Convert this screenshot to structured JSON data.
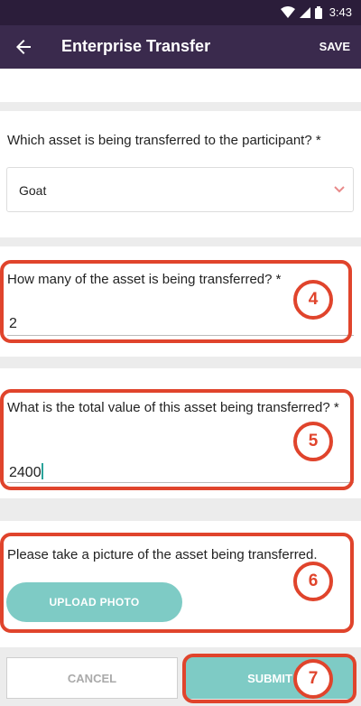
{
  "status_bar": {
    "time": "3:43",
    "icons": [
      "wifi-icon",
      "signal-icon",
      "battery-icon"
    ]
  },
  "app_bar": {
    "title": "Enterprise Transfer",
    "save_label": "SAVE"
  },
  "questions": {
    "asset_type": {
      "label": "Which asset is being transferred to the participant? *",
      "value": "Goat"
    },
    "asset_quantity": {
      "label": "How many of the asset is being transferred? *",
      "value": "2",
      "annotation": "4"
    },
    "asset_value": {
      "label": "What is the total value of this asset being transferred? *",
      "value": "2400",
      "annotation": "5"
    },
    "asset_photo": {
      "label": "Please take a picture of the asset being transferred.",
      "button_label": "UPLOAD PHOTO",
      "annotation": "6"
    }
  },
  "footer": {
    "cancel_label": "CANCEL",
    "submit_label": "SUBMIT",
    "submit_annotation": "7"
  },
  "colors": {
    "app_bar": "#3a2a4d",
    "status_bar": "#2b1d3a",
    "accent": "#7ecbc5",
    "annotation": "#e0442c"
  }
}
